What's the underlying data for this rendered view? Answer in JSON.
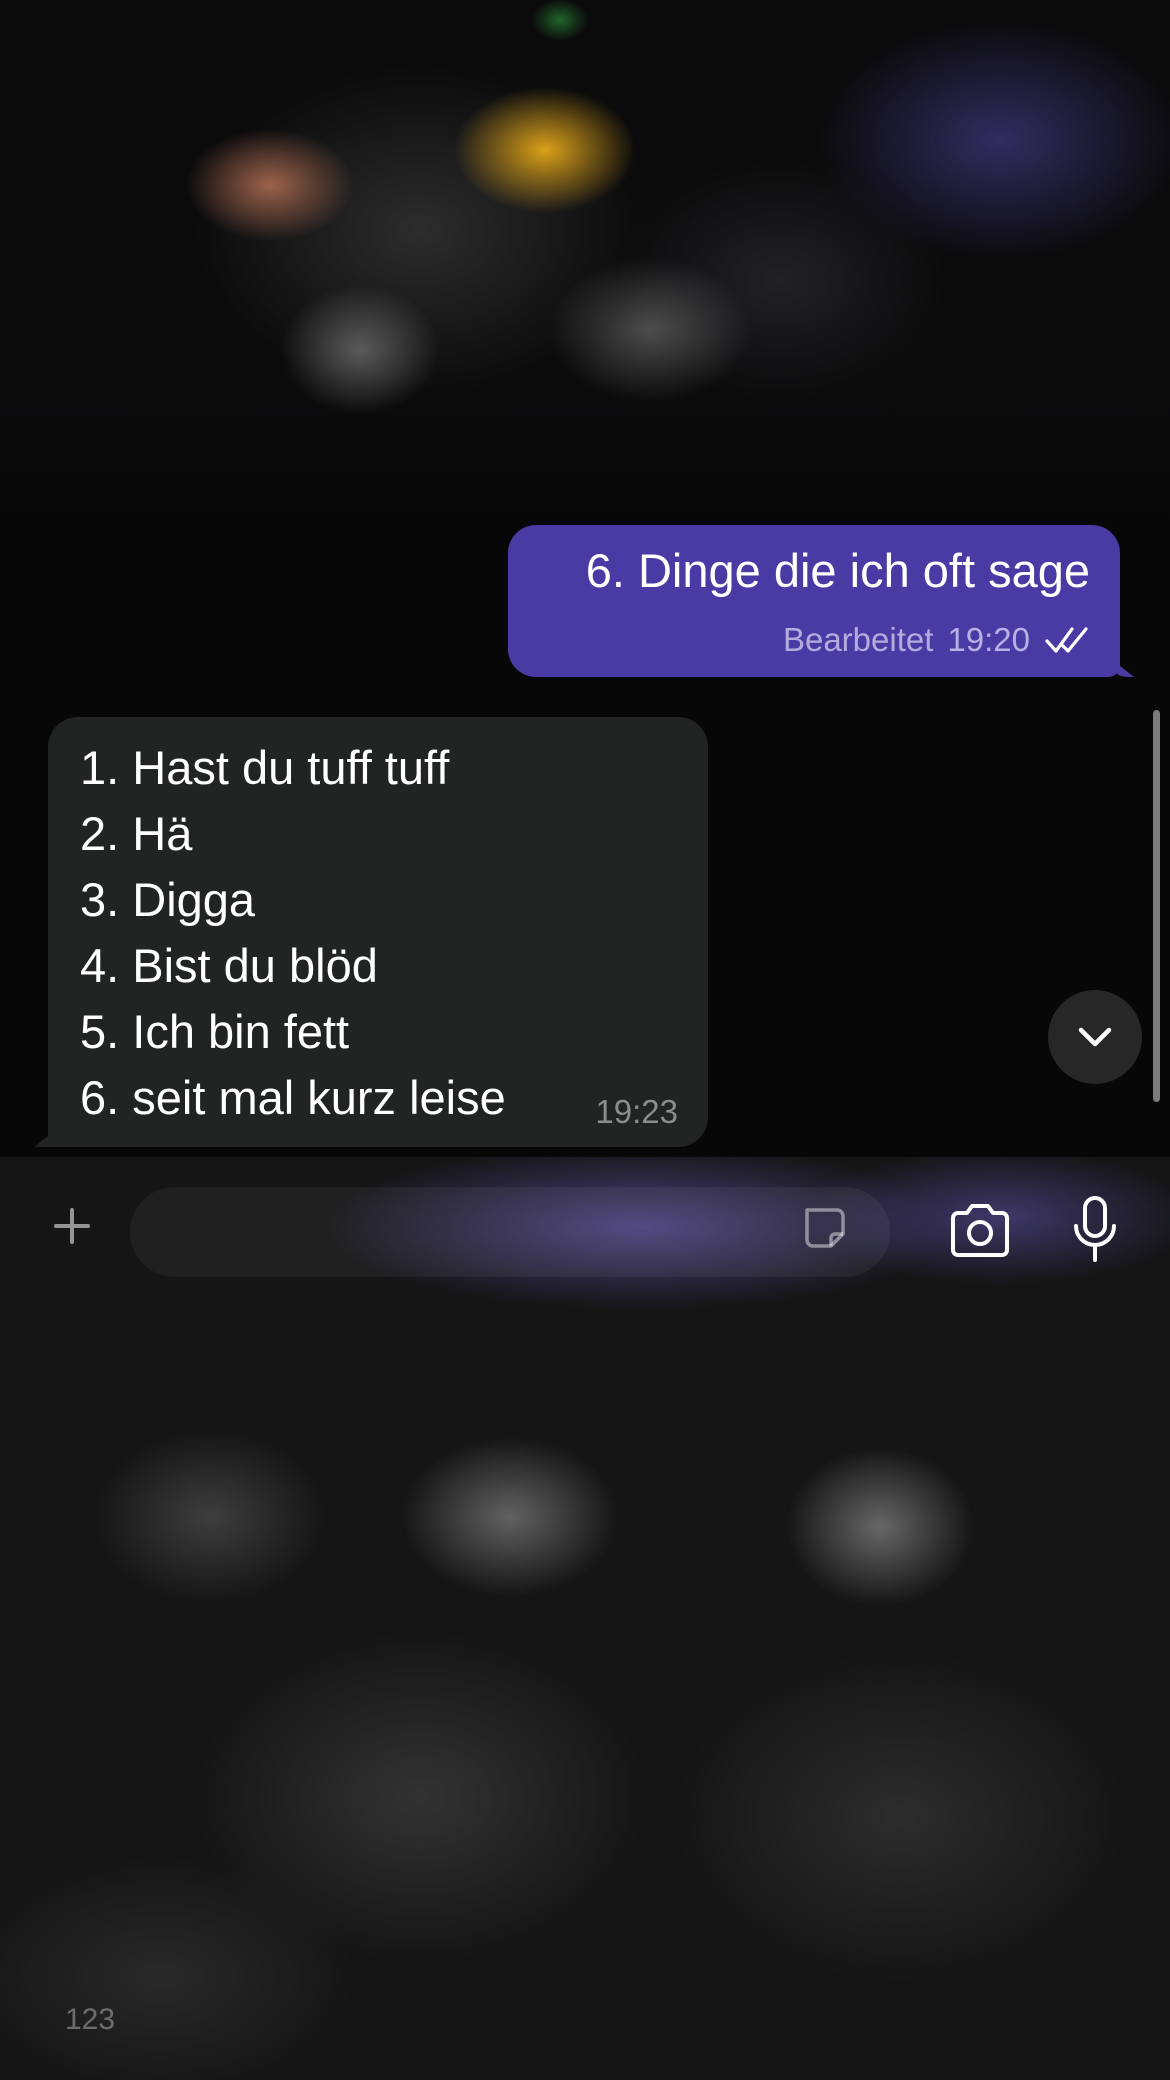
{
  "chat": {
    "messages": [
      {
        "direction": "outgoing",
        "text": "6. Dinge die ich oft sage",
        "edited_label": "Bearbeitet",
        "time": "19:20",
        "status": "read"
      },
      {
        "direction": "incoming",
        "lines": [
          "1. Hast du tuff tuff",
          "2. Hä",
          "3. Digga",
          "4. Bist du blöd",
          "5. Ich bin fett",
          "6. seit mal kurz leise"
        ],
        "time": "19:23"
      }
    ]
  },
  "input_bar": {
    "icons": [
      "plus-icon",
      "sticker-icon",
      "camera-icon",
      "microphone-icon"
    ]
  },
  "keyboard": {
    "mode_key": "123"
  },
  "colors": {
    "outgoing_bubble": "#4a3aa3",
    "incoming_bubble": "#222424",
    "background": "#070707"
  }
}
